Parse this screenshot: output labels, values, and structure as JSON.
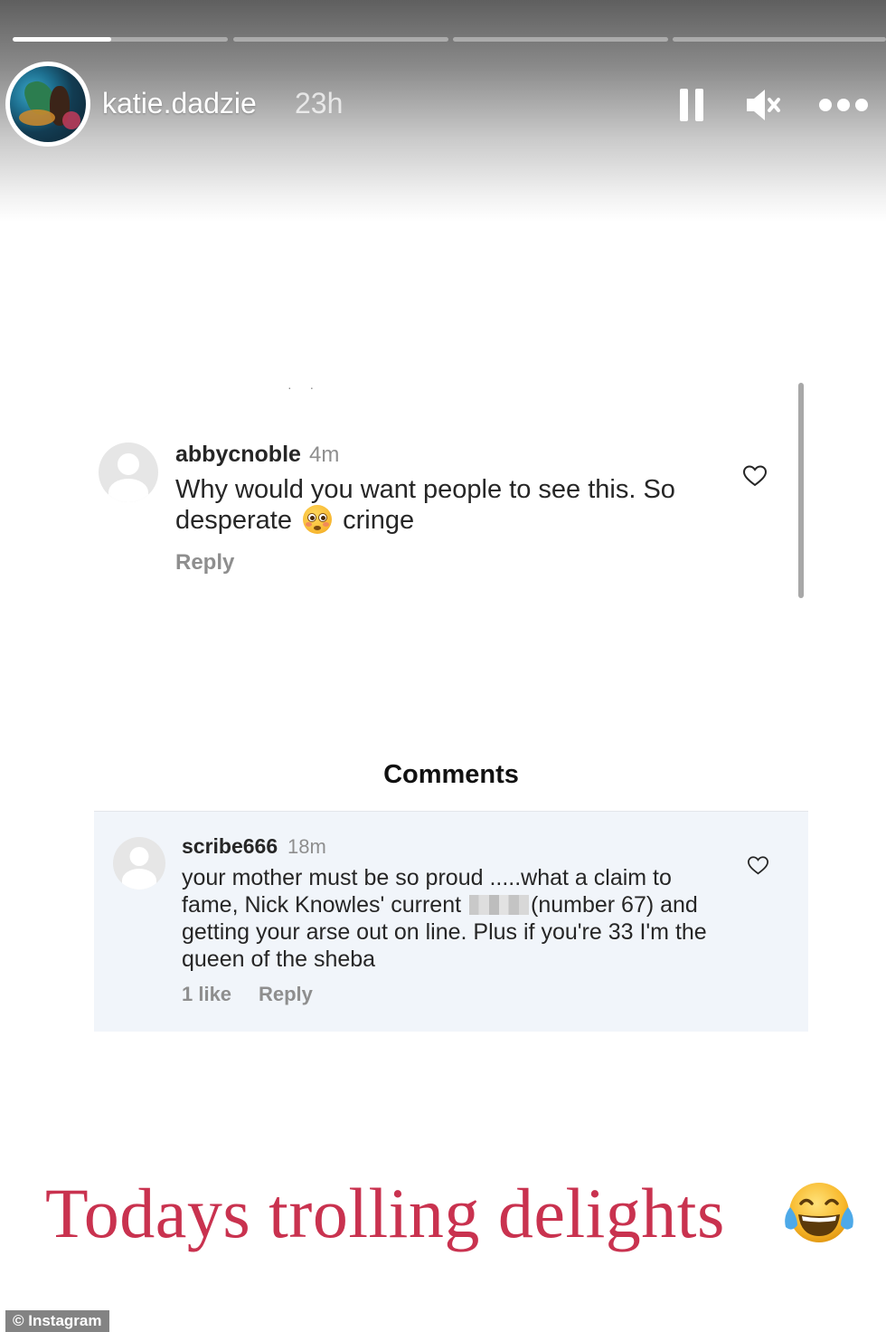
{
  "story": {
    "username": "katie.dadzie",
    "time": "23h",
    "progress": [
      {
        "fill": 0.46
      },
      {
        "fill": 0
      },
      {
        "fill": 0
      },
      {
        "fill": 0
      }
    ],
    "controls": {
      "pause_icon": "pause-icon",
      "mute_icon": "speaker-muted-icon",
      "more_icon": "more-horizontal-icon"
    }
  },
  "comment1": {
    "username": "abbycnoble",
    "time": "4m",
    "text_before_emoji": "Why would you want people to see this. So desperate ",
    "emoji": "flushed-face-emoji",
    "text_after_emoji": " cringe",
    "reply_label": "Reply",
    "heart_icon": "heart-outline-icon"
  },
  "comments_panel": {
    "title": "Comments",
    "comment": {
      "username": "scribe666",
      "time": "18m",
      "text_before_censor": "your mother must be so proud .....what a claim to fame, Nick Knowles' current ",
      "text_after_censor": "(number 67) and getting your arse out on line. Plus if you're 33 I'm the queen of the sheba",
      "likes_label": "1 like",
      "reply_label": "Reply",
      "heart_icon": "heart-outline-icon"
    }
  },
  "caption": {
    "text": "Todays trolling delights",
    "emoji": "face-with-tears-of-joy-emoji",
    "color": "#c9324f"
  },
  "watermark": "© Instagram"
}
